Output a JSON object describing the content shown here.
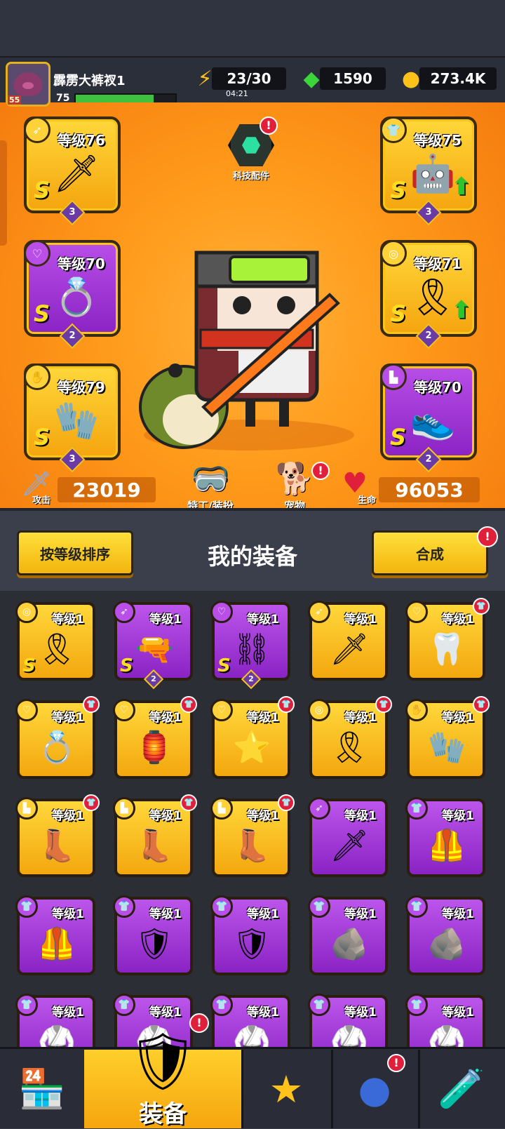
{
  "player": {
    "name": "霹雳大裤衩1",
    "level": "75",
    "rank": "55",
    "xp_fraction": 0.78
  },
  "resources": {
    "energy": "23/30",
    "energy_timer": "04:21",
    "gems": "1590",
    "coins": "273.4K"
  },
  "tech": {
    "label": "科技配件",
    "badge": "!"
  },
  "equipped": {
    "weapon": {
      "level": "等级76",
      "rank": "S",
      "stars": "3"
    },
    "armor": {
      "level": "等级75",
      "rank": "S",
      "stars": "3"
    },
    "ring": {
      "level": "等级70",
      "rank": "S",
      "stars": "2"
    },
    "belt": {
      "level": "等级71",
      "rank": "S",
      "stars": "2"
    },
    "glove": {
      "level": "等级79",
      "rank": "S",
      "stars": "3"
    },
    "boot": {
      "level": "等级70",
      "rank": "S",
      "stars": "2"
    }
  },
  "stats": {
    "attack_label": "攻击",
    "attack": "23019",
    "hp_label": "生命",
    "hp": "96053"
  },
  "mid_buttons": {
    "agent": "特工/装扮",
    "pet": "宠物",
    "pet_badge": "!"
  },
  "panel": {
    "sort_label": "按等级排序",
    "title": "我的装备",
    "merge_label": "合成",
    "merge_badge": "!"
  },
  "items": [
    {
      "level": "等级1",
      "tier": "gold",
      "cat": "belt",
      "rank": "S",
      "stars": "",
      "new": false,
      "icon": "belt"
    },
    {
      "level": "等级1",
      "tier": "purple",
      "cat": "weapon",
      "rank": "S",
      "stars": "2",
      "new": false,
      "icon": "gun"
    },
    {
      "level": "等级1",
      "tier": "purple",
      "cat": "necklace",
      "rank": "S",
      "stars": "2",
      "new": false,
      "icon": "chain"
    },
    {
      "level": "等级1",
      "tier": "gold",
      "cat": "weapon",
      "rank": "",
      "stars": "",
      "new": false,
      "icon": "kunai"
    },
    {
      "level": "等级1",
      "tier": "gold",
      "cat": "necklace",
      "rank": "",
      "stars": "",
      "new": true,
      "icon": "fang-necklace"
    },
    {
      "level": "等级1",
      "tier": "gold",
      "cat": "necklace",
      "rank": "",
      "stars": "",
      "new": true,
      "icon": "emerald-ring"
    },
    {
      "level": "等级1",
      "tier": "gold",
      "cat": "necklace",
      "rank": "",
      "stars": "",
      "new": true,
      "icon": "lantern-pendant"
    },
    {
      "level": "等级1",
      "tier": "gold",
      "cat": "necklace",
      "rank": "",
      "stars": "",
      "new": true,
      "icon": "star-pendant"
    },
    {
      "level": "等级1",
      "tier": "gold",
      "cat": "belt",
      "rank": "",
      "stars": "",
      "new": true,
      "icon": "belt"
    },
    {
      "level": "等级1",
      "tier": "gold",
      "cat": "glove",
      "rank": "",
      "stars": "",
      "new": true,
      "icon": "gauntlet"
    },
    {
      "level": "等级1",
      "tier": "gold",
      "cat": "boot",
      "rank": "",
      "stars": "",
      "new": true,
      "icon": "boot"
    },
    {
      "level": "等级1",
      "tier": "gold",
      "cat": "boot",
      "rank": "",
      "stars": "",
      "new": true,
      "icon": "boot"
    },
    {
      "level": "等级1",
      "tier": "gold",
      "cat": "boot",
      "rank": "",
      "stars": "",
      "new": true,
      "icon": "boot"
    },
    {
      "level": "等级1",
      "tier": "purple",
      "cat": "weapon",
      "rank": "",
      "stars": "",
      "new": false,
      "icon": "kunai"
    },
    {
      "level": "等级1",
      "tier": "purple",
      "cat": "armor",
      "rank": "",
      "stars": "",
      "new": false,
      "icon": "green-armor"
    },
    {
      "level": "等级1",
      "tier": "purple",
      "cat": "armor",
      "rank": "",
      "stars": "",
      "new": false,
      "icon": "green-armor"
    },
    {
      "level": "等级1",
      "tier": "purple",
      "cat": "armor",
      "rank": "",
      "stars": "",
      "new": false,
      "icon": "steel-armor"
    },
    {
      "level": "等级1",
      "tier": "purple",
      "cat": "armor",
      "rank": "",
      "stars": "",
      "new": false,
      "icon": "steel-armor"
    },
    {
      "level": "等级1",
      "tier": "purple",
      "cat": "armor",
      "rank": "",
      "stars": "",
      "new": false,
      "icon": "stone-armor"
    },
    {
      "level": "等级1",
      "tier": "purple",
      "cat": "armor",
      "rank": "",
      "stars": "",
      "new": false,
      "icon": "stone-armor"
    },
    {
      "level": "等级1",
      "tier": "purple",
      "cat": "armor",
      "rank": "",
      "stars": "",
      "new": false,
      "icon": "armor"
    },
    {
      "level": "等级1",
      "tier": "purple",
      "cat": "armor",
      "rank": "",
      "stars": "",
      "new": false,
      "icon": "armor"
    },
    {
      "level": "等级1",
      "tier": "purple",
      "cat": "armor",
      "rank": "",
      "stars": "",
      "new": false,
      "icon": "armor"
    },
    {
      "level": "等级1",
      "tier": "purple",
      "cat": "armor",
      "rank": "",
      "stars": "",
      "new": false,
      "icon": "armor"
    },
    {
      "level": "等级1",
      "tier": "purple",
      "cat": "armor",
      "rank": "",
      "stars": "",
      "new": false,
      "icon": "armor"
    }
  ],
  "nav": {
    "equipment_label": "装备",
    "equipment_badge": "!",
    "explore_badge": "!"
  },
  "colors": {
    "gold": "#ffd73a",
    "purple": "#a53ad8",
    "orange": "#ff9a1a",
    "badge": "#e0203a"
  }
}
